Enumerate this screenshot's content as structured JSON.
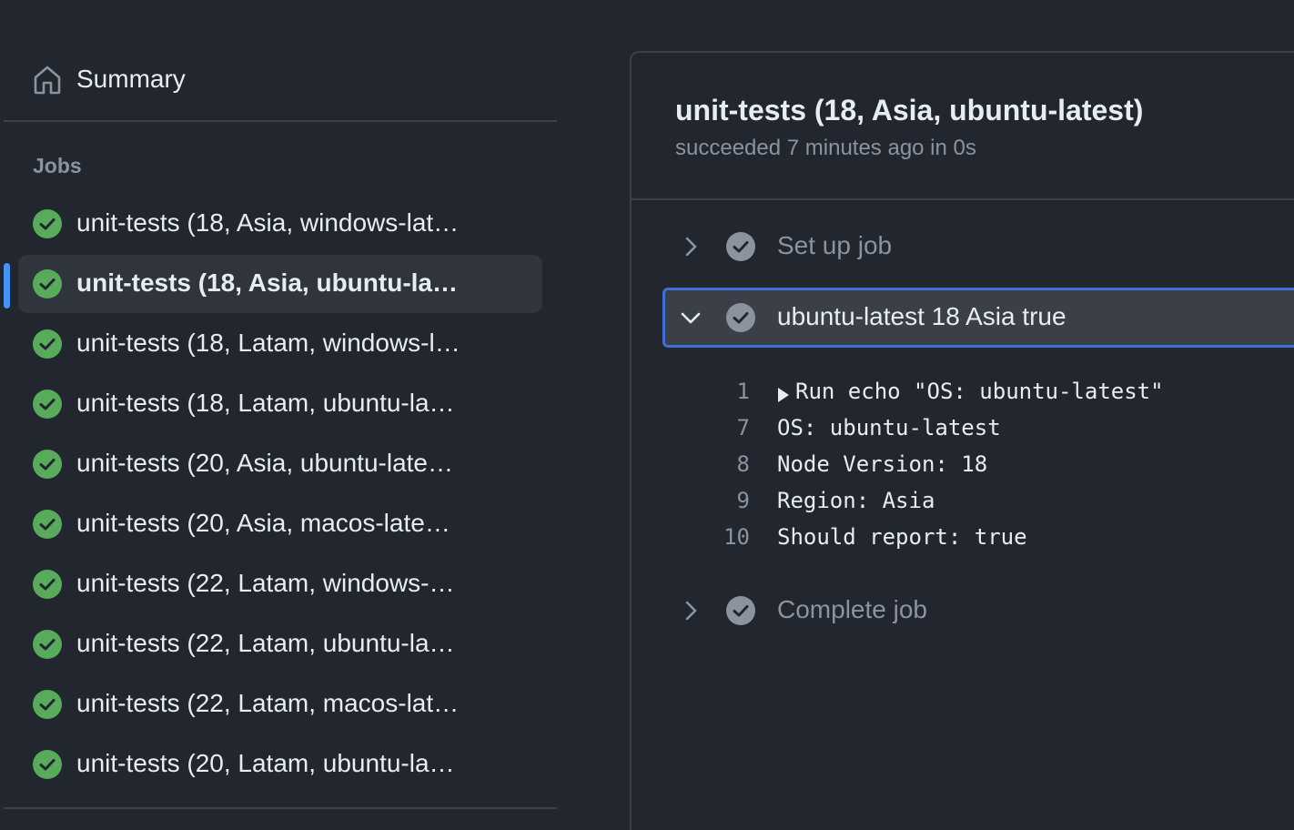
{
  "sidebar": {
    "summary_label": "Summary",
    "summary_icon": "home-icon",
    "jobs_heading": "Jobs",
    "jobs": [
      {
        "label": "unit-tests (18, Asia, windows-lat…",
        "status": "success",
        "active": false
      },
      {
        "label": "unit-tests (18, Asia, ubuntu-la…",
        "status": "success",
        "active": true
      },
      {
        "label": "unit-tests (18, Latam, windows-l…",
        "status": "success",
        "active": false
      },
      {
        "label": "unit-tests (18, Latam, ubuntu-la…",
        "status": "success",
        "active": false
      },
      {
        "label": "unit-tests (20, Asia, ubuntu-late…",
        "status": "success",
        "active": false
      },
      {
        "label": "unit-tests (20, Asia, macos-late…",
        "status": "success",
        "active": false
      },
      {
        "label": "unit-tests (22, Latam, windows-…",
        "status": "success",
        "active": false
      },
      {
        "label": "unit-tests (22, Latam, ubuntu-la…",
        "status": "success",
        "active": false
      },
      {
        "label": "unit-tests (22, Latam, macos-lat…",
        "status": "success",
        "active": false
      },
      {
        "label": "unit-tests (20, Latam, ubuntu-la…",
        "status": "success",
        "active": false
      }
    ]
  },
  "main": {
    "title": "unit-tests (18, Asia, ubuntu-latest)",
    "subtitle": "succeeded 7 minutes ago in 0s",
    "steps": [
      {
        "label": "Set up job",
        "expanded": false,
        "status": "success"
      },
      {
        "label": "ubuntu-latest 18 Asia true",
        "expanded": true,
        "status": "success"
      },
      {
        "label": "Complete job",
        "expanded": false,
        "status": "success"
      }
    ],
    "log": [
      {
        "line": "1",
        "text": "Run echo \"OS: ubuntu-latest\"",
        "collapsible": true
      },
      {
        "line": "7",
        "text": "OS: ubuntu-latest",
        "collapsible": false
      },
      {
        "line": "8",
        "text": "Node Version: 18",
        "collapsible": false
      },
      {
        "line": "9",
        "text": "Region: Asia",
        "collapsible": false
      },
      {
        "line": "10",
        "text": "Should report: true",
        "collapsible": false
      }
    ]
  },
  "colors": {
    "background": "#22262e",
    "success": "#57ab5a",
    "step_check": "#8b949e",
    "accent": "#4493f8",
    "expanded_border": "#3f6fd6"
  }
}
